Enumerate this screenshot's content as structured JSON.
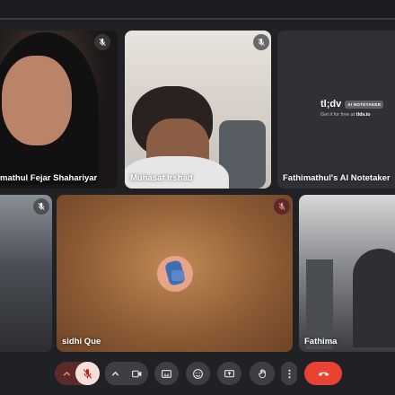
{
  "participants": [
    {
      "name": "mathul Fejar Shahariyar",
      "muted": true
    },
    {
      "name": "Muhasaf Irshad",
      "muted": true
    },
    {
      "name": "Fathimathul's AI Notetaker",
      "muted": false
    },
    {
      "name": "",
      "muted": true
    },
    {
      "name": "sidhi Que",
      "muted": true
    },
    {
      "name": "Fathima",
      "muted": false
    }
  ],
  "notetaker": {
    "logo": "tl;dv",
    "badge": "AI NOTETAKER",
    "tagline_prefix": "Get it for free at ",
    "tagline_link": "tldv.io"
  },
  "toolbar": {
    "buttons": [
      {
        "icon": "chevron-up-icon",
        "state": "active-red"
      },
      {
        "icon": "mic-off-icon",
        "state": "off"
      },
      {
        "icon": "chevron-up-icon",
        "state": "normal"
      },
      {
        "icon": "camera-icon",
        "state": "on"
      },
      {
        "icon": "captions-icon",
        "state": "normal"
      },
      {
        "icon": "emoji-icon",
        "state": "normal"
      },
      {
        "icon": "present-icon",
        "state": "normal"
      },
      {
        "icon": "raise-hand-icon",
        "state": "normal"
      },
      {
        "icon": "more-vert-icon",
        "state": "normal"
      },
      {
        "icon": "end-call-icon",
        "state": "danger"
      }
    ]
  },
  "colors": {
    "background": "#202124",
    "control": "#3c4043",
    "mic_off_bg": "#f9dedc",
    "end_call": "#ea4335"
  }
}
